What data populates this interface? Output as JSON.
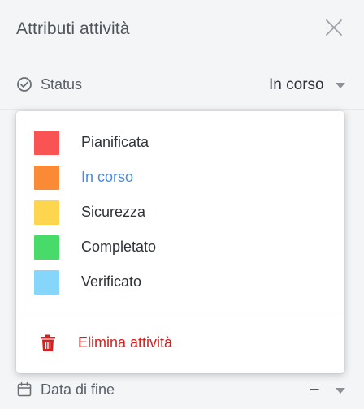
{
  "panel": {
    "title": "Attributi attività"
  },
  "status_row": {
    "label": "Status",
    "value": "In corso"
  },
  "status_dropdown": {
    "options": [
      {
        "label": "Pianificata",
        "color": "#f95353"
      },
      {
        "label": "In corso",
        "color": "#fb8a36"
      },
      {
        "label": "Sicurezza",
        "color": "#fdd54e"
      },
      {
        "label": "Completato",
        "color": "#48db69"
      },
      {
        "label": "Verificato",
        "color": "#86d6fc"
      }
    ],
    "selected_index": 1,
    "delete_label": "Elimina attività",
    "delete_color": "#d61f1f"
  },
  "end_date_row": {
    "label": "Data di fine",
    "value": "–"
  },
  "icons": {
    "close": "close-icon",
    "status": "check-circle-icon",
    "calendar": "calendar-icon",
    "trash": "trash-icon",
    "caret": "chevron-down-icon"
  }
}
